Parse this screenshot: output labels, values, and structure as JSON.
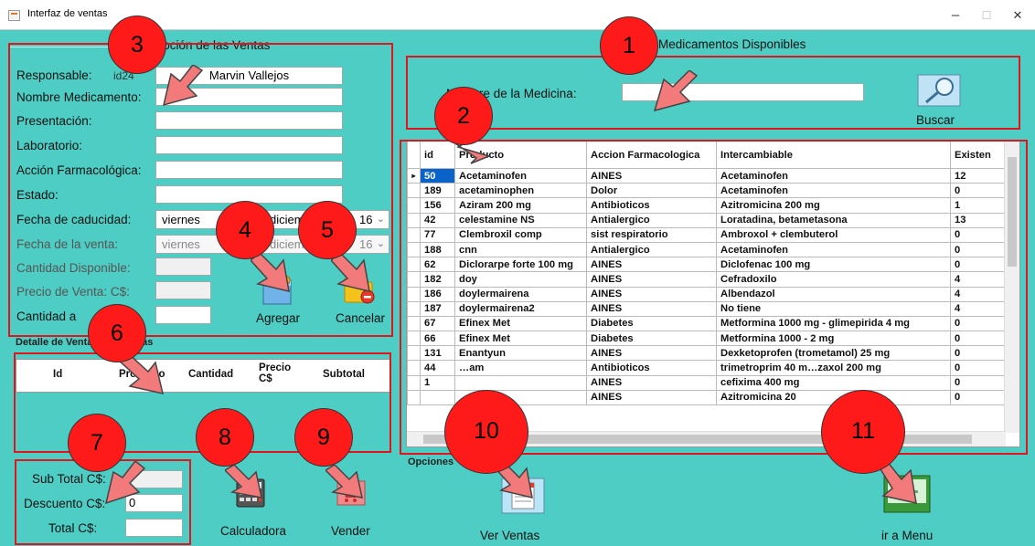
{
  "window": {
    "title": "Interfaz de ventas",
    "minimize": "–",
    "maximize": "☐",
    "close": "✕"
  },
  "left": {
    "group_title": "Descripción de las Ventas",
    "responsable_label": "Responsable:",
    "responsable_id": "id24",
    "responsable_value": "Marvin Vallejos",
    "nombre_label": "Nombre Medicamento:",
    "presentacion_label": "Presentación:",
    "laboratorio_label": "Laboratorio:",
    "accion_label": "Acción Farmacológica:",
    "estado_label": "Estado:",
    "caducidad_label": "Fecha de caducidad:",
    "caducidad_day": "viernes",
    "caducidad_month": "diciem",
    "caducidad_year": "16",
    "venta_label": "Fecha de la venta:",
    "venta_day": "viernes",
    "venta_month": "diciem",
    "venta_year": "16",
    "cantidad_disp_label": "Cantidad Disponible:",
    "precio_label": "Precio de Venta:  C$:",
    "cantidad_a_label": "Cantidad a",
    "agregar_label": "Agregar",
    "cancelar_label": "Cancelar"
  },
  "detalle": {
    "group_title": "Detalle de Ventas Realizadas",
    "columns": [
      "Id",
      "Producto",
      "Cantidad",
      "Precio C$",
      "Subtotal"
    ]
  },
  "totals": {
    "subtotal_label": "Sub Total C$:",
    "descuento_label": "Descuento C$:",
    "descuento_value": "0",
    "total_label": "Total  C$:",
    "calculadora_label": "Calculadora",
    "vender_label": "Vender"
  },
  "right": {
    "group_title": "Medicamentos Disponibles",
    "search_label": "Nombre de la Medicina:",
    "search_value": "",
    "buscar_label": "Buscar",
    "opciones_label": "Opciones",
    "ver_ventas_label": "Ver Ventas",
    "ir_menu_label": "ir a Menu"
  },
  "grid": {
    "columns": [
      "id",
      "Producto",
      "Accion Farmacologica",
      "Intercambiable",
      "Existen"
    ],
    "rows": [
      [
        "50",
        "Acetaminofen",
        "AINES",
        "Acetaminofen",
        "12"
      ],
      [
        "189",
        "acetaminophen",
        "Dolor",
        "Acetaminofen",
        "0"
      ],
      [
        "156",
        "Aziram 200 mg",
        "Antibioticos",
        " Azitromicina 200 mg",
        "1"
      ],
      [
        "42",
        "celestamine NS",
        "Antialergico",
        "Loratadina, betametasona",
        "13"
      ],
      [
        "77",
        "Clembroxil comp",
        "sist respiratorio",
        "Ambroxol + clembuterol",
        "0"
      ],
      [
        "188",
        "cnn",
        "Antialergico",
        "Acetaminofen",
        "0"
      ],
      [
        "62",
        "Diclorarpe forte 100 mg",
        "AINES",
        "Diclofenac 100 mg",
        "0"
      ],
      [
        "182",
        "doy",
        "AINES",
        "Cefradoxilo",
        "4"
      ],
      [
        "186",
        "doylermairena",
        "AINES",
        "Albendazol",
        "4"
      ],
      [
        "187",
        "doylermairena2",
        "AINES",
        "No tiene",
        "4"
      ],
      [
        "67",
        "Efinex Met",
        "Diabetes",
        "Metformina 1000 mg - glimepirida 4 mg",
        "0"
      ],
      [
        "66",
        "Efinex Met",
        "Diabetes",
        "Metformina 1000 - 2 mg",
        "0"
      ],
      [
        "131",
        "Enantyun",
        "AINES",
        "Dexketoprofen (trometamol) 25 mg",
        "0"
      ],
      [
        "44",
        "…am",
        "Antibioticos",
        "trimetroprim 40 m…zaxol 200 mg",
        "0"
      ],
      [
        "1",
        "",
        "AINES",
        "cefixima 400 mg",
        "0"
      ],
      [
        "",
        "",
        "AINES",
        " Azitromicina 20",
        "0"
      ]
    ]
  },
  "callouts": [
    "1",
    "2",
    "3",
    "4",
    "5",
    "6",
    "7",
    "8",
    "9",
    "10",
    "11"
  ],
  "colors": {
    "background": "#4ecdc4",
    "highlight_box": "#e0151e",
    "callout": "#ff1a1a",
    "selected_id": "#0a63c9"
  }
}
